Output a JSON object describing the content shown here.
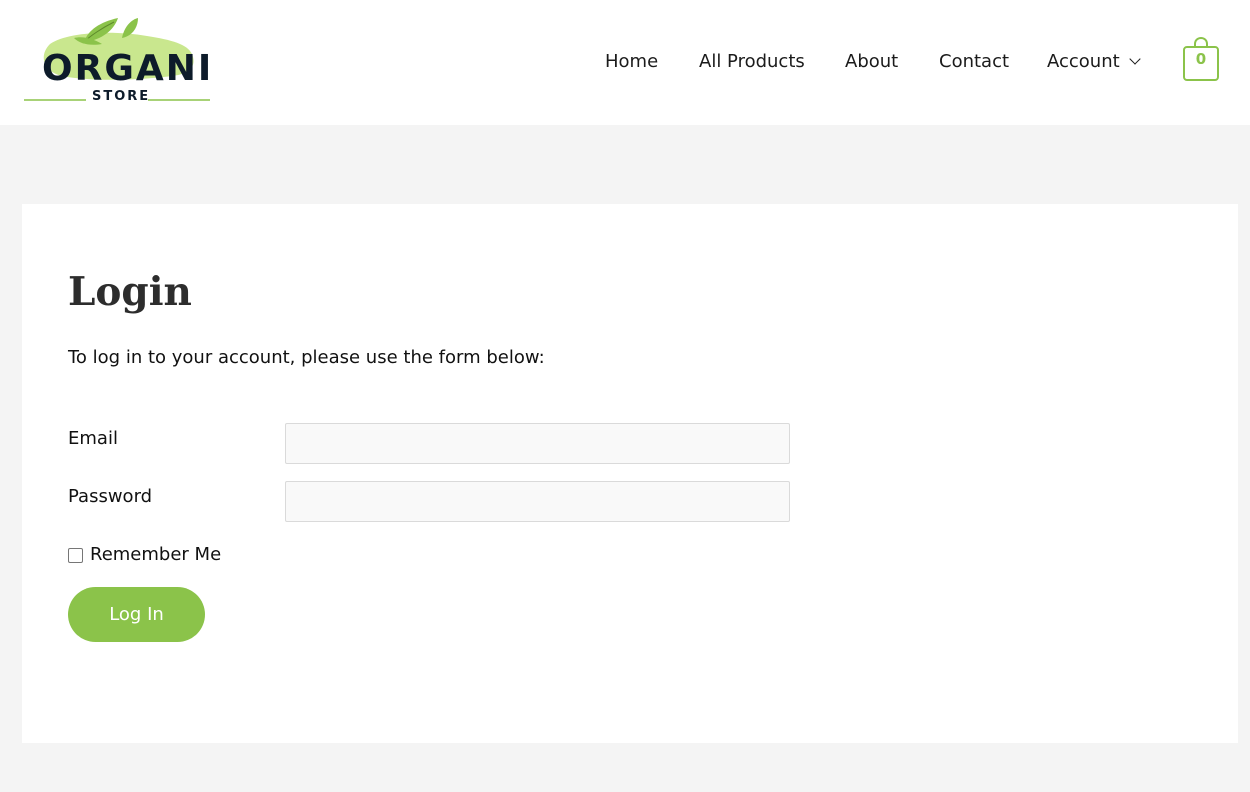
{
  "header": {
    "logo": {
      "main_text": "ORGANIC",
      "sub_text": "STORE",
      "leaf_color": "#8bc34a",
      "splash_color": "#c9e78e",
      "text_color": "#0d1b2a"
    },
    "nav": {
      "items": [
        {
          "label": "Home"
        },
        {
          "label": "All Products"
        },
        {
          "label": "About"
        },
        {
          "label": "Contact"
        },
        {
          "label": "Account",
          "icon": "chevron-down-icon"
        }
      ]
    },
    "cart": {
      "icon": "shopping-bag-icon",
      "count": "0",
      "color": "#8bc34a"
    }
  },
  "login": {
    "title": "Login",
    "intro": "To log in to your account, please use the form below:",
    "email_label": "Email",
    "email_value": "",
    "password_label": "Password",
    "password_value": "",
    "remember_label": "Remember Me",
    "remember_checked": false,
    "submit_label": "Log In",
    "accent_color": "#8bc34a"
  }
}
